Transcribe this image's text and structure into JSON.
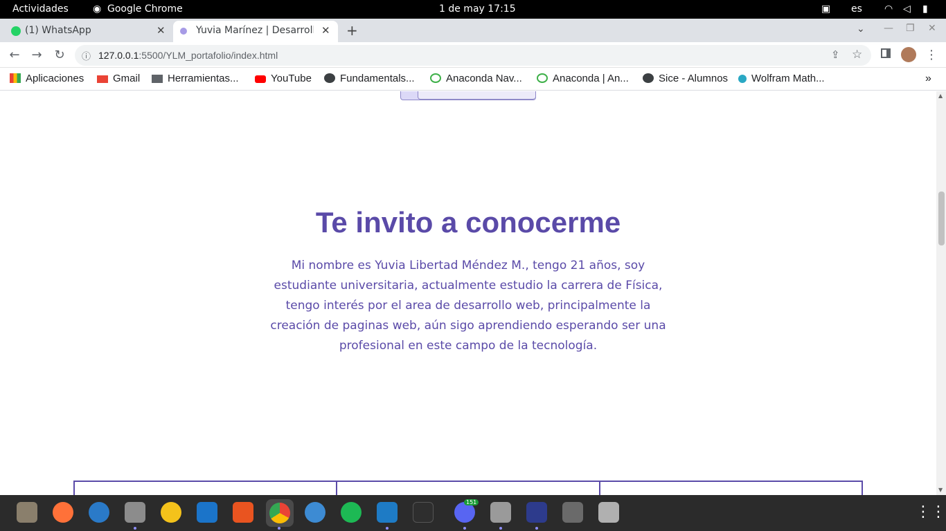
{
  "system": {
    "activities": "Actividades",
    "app_name": "Google Chrome",
    "datetime": "1 de may  17:15",
    "lang": "es"
  },
  "tabs": [
    {
      "label": "(1) WhatsApp",
      "close": "✕"
    },
    {
      "label": "Yuvia Marínez | Desarrollo",
      "close": "✕"
    }
  ],
  "new_tab": "+",
  "window_controls": [
    "⌄",
    "—",
    "❐",
    "✕"
  ],
  "toolbar": {
    "back": "←",
    "forward": "→",
    "reload": "↻",
    "url_host": "127.0.0.1",
    "url_path": ":5500/YLM_portafolio/index.html",
    "share": "⇪",
    "star": "☆",
    "more": "⋮"
  },
  "bookmarks": [
    {
      "label": "Aplicaciones",
      "color": "#4285f4"
    },
    {
      "label": "Gmail",
      "color": "#ea4335"
    },
    {
      "label": "Herramientas...",
      "color": "#5f6368"
    },
    {
      "label": "YouTube",
      "color": "#ff0000"
    },
    {
      "label": "Fundamentals...",
      "color": "#3c4043"
    },
    {
      "label": "Anaconda Nav...",
      "color": "#3eb049"
    },
    {
      "label": "Anaconda | An...",
      "color": "#3eb049"
    },
    {
      "label": "Sice - Alumnos",
      "color": "#3c4043"
    },
    {
      "label": "Wolfram Math...",
      "color": "#2aa8c4"
    }
  ],
  "bookmarks_more": "»",
  "page": {
    "heading": "Te invito a conocerme",
    "about_lines": [
      "Mi nombre es Yuvia Libertad Méndez M., tengo 21 años, soy",
      "estudiante universitaria, actualmente estudio la carrera de Física,",
      "tengo interés por el area de desarrollo web, principalmente la",
      "creación de paginas web, aún sigo aprendiendo esperando ser una",
      "profesional en este campo de la tecnología."
    ],
    "accent": "#5a4aa8"
  },
  "dock": {
    "discord_badge": "151",
    "apps": [
      "gimp",
      "firefox",
      "thunderbird",
      "files",
      "rhythmbox",
      "writer",
      "software",
      "chrome",
      "help",
      "spotify",
      "vscode",
      "terminal",
      "discord",
      "image-viewer",
      "kicad",
      "ssd",
      "trash"
    ]
  }
}
